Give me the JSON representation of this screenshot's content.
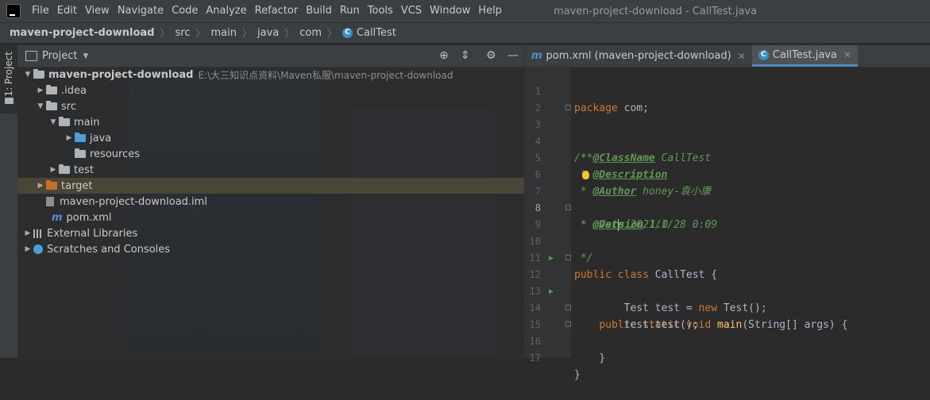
{
  "menubar": {
    "items": [
      "File",
      "Edit",
      "View",
      "Navigate",
      "Code",
      "Analyze",
      "Refactor",
      "Build",
      "Run",
      "Tools",
      "VCS",
      "Window",
      "Help"
    ],
    "window_title": "maven-project-download - CallTest.java"
  },
  "breadcrumb": [
    "maven-project-download",
    "src",
    "main",
    "java",
    "com",
    "CallTest"
  ],
  "strip": {
    "project_label": "1: Project"
  },
  "project_panel": {
    "title": "Project",
    "tree": {
      "root": {
        "name": "maven-project-download",
        "path": "E:\\大三知识点资料\\Maven私服\\maven-project-download"
      },
      "idea": ".idea",
      "src": "src",
      "main": "main",
      "java": "java",
      "resources": "resources",
      "test": "test",
      "target": "target",
      "iml": "maven-project-download.iml",
      "pom": "pom.xml",
      "external": "External Libraries",
      "scratches": "Scratches and Consoles"
    }
  },
  "editor": {
    "tabs": [
      {
        "label": "pom.xml (maven-project-download)",
        "active": false
      },
      {
        "label": "CallTest.java",
        "active": true
      }
    ],
    "line_numbers": [
      "1",
      "2",
      "3",
      "4",
      "5",
      "6",
      "7",
      "8",
      "9",
      "10",
      "11",
      "12",
      "13",
      "14",
      "15",
      "16",
      "17"
    ],
    "current_line": 8,
    "code": {
      "l1_kw": "package",
      "l1_rest": " com;",
      "l3": "/**",
      "l4_star": " * ",
      "l4_tag": "@ClassName",
      "l4_rest": " CallTest",
      "l5_star": " * ",
      "l5_tag": "@Description",
      "l6_star": " * ",
      "l6_tag": "@Author",
      "l6_rest": " honey-袁小康",
      "l7_star": " * ",
      "l7_tag": "@Date",
      "l7_rest": " 2021/1/28 0:09",
      "l8_star": " * ",
      "l8_tag_a": "@Ver",
      "l8_tag_b": "sion",
      "l8_rest": " 1.0",
      "l9": " */",
      "l10_kw": "public class",
      "l10_rest": " CallTest {",
      "l12_indent": "    ",
      "l12_kw": "public static void",
      "l12_sp": " ",
      "l12_fn": "main",
      "l12_rest": "(String[] args) {",
      "l13_indent": "        ",
      "l13_a": "Test test = ",
      "l13_kw": "new",
      "l13_b": " Test();",
      "l14": "        test.test();",
      "l15": "    }",
      "l16": "}"
    }
  },
  "colors": {
    "keyword": "#cc7832",
    "doc": "#629755",
    "function": "#ffc66d",
    "plain": "#a9b7c6",
    "selection": "#4a4637"
  }
}
